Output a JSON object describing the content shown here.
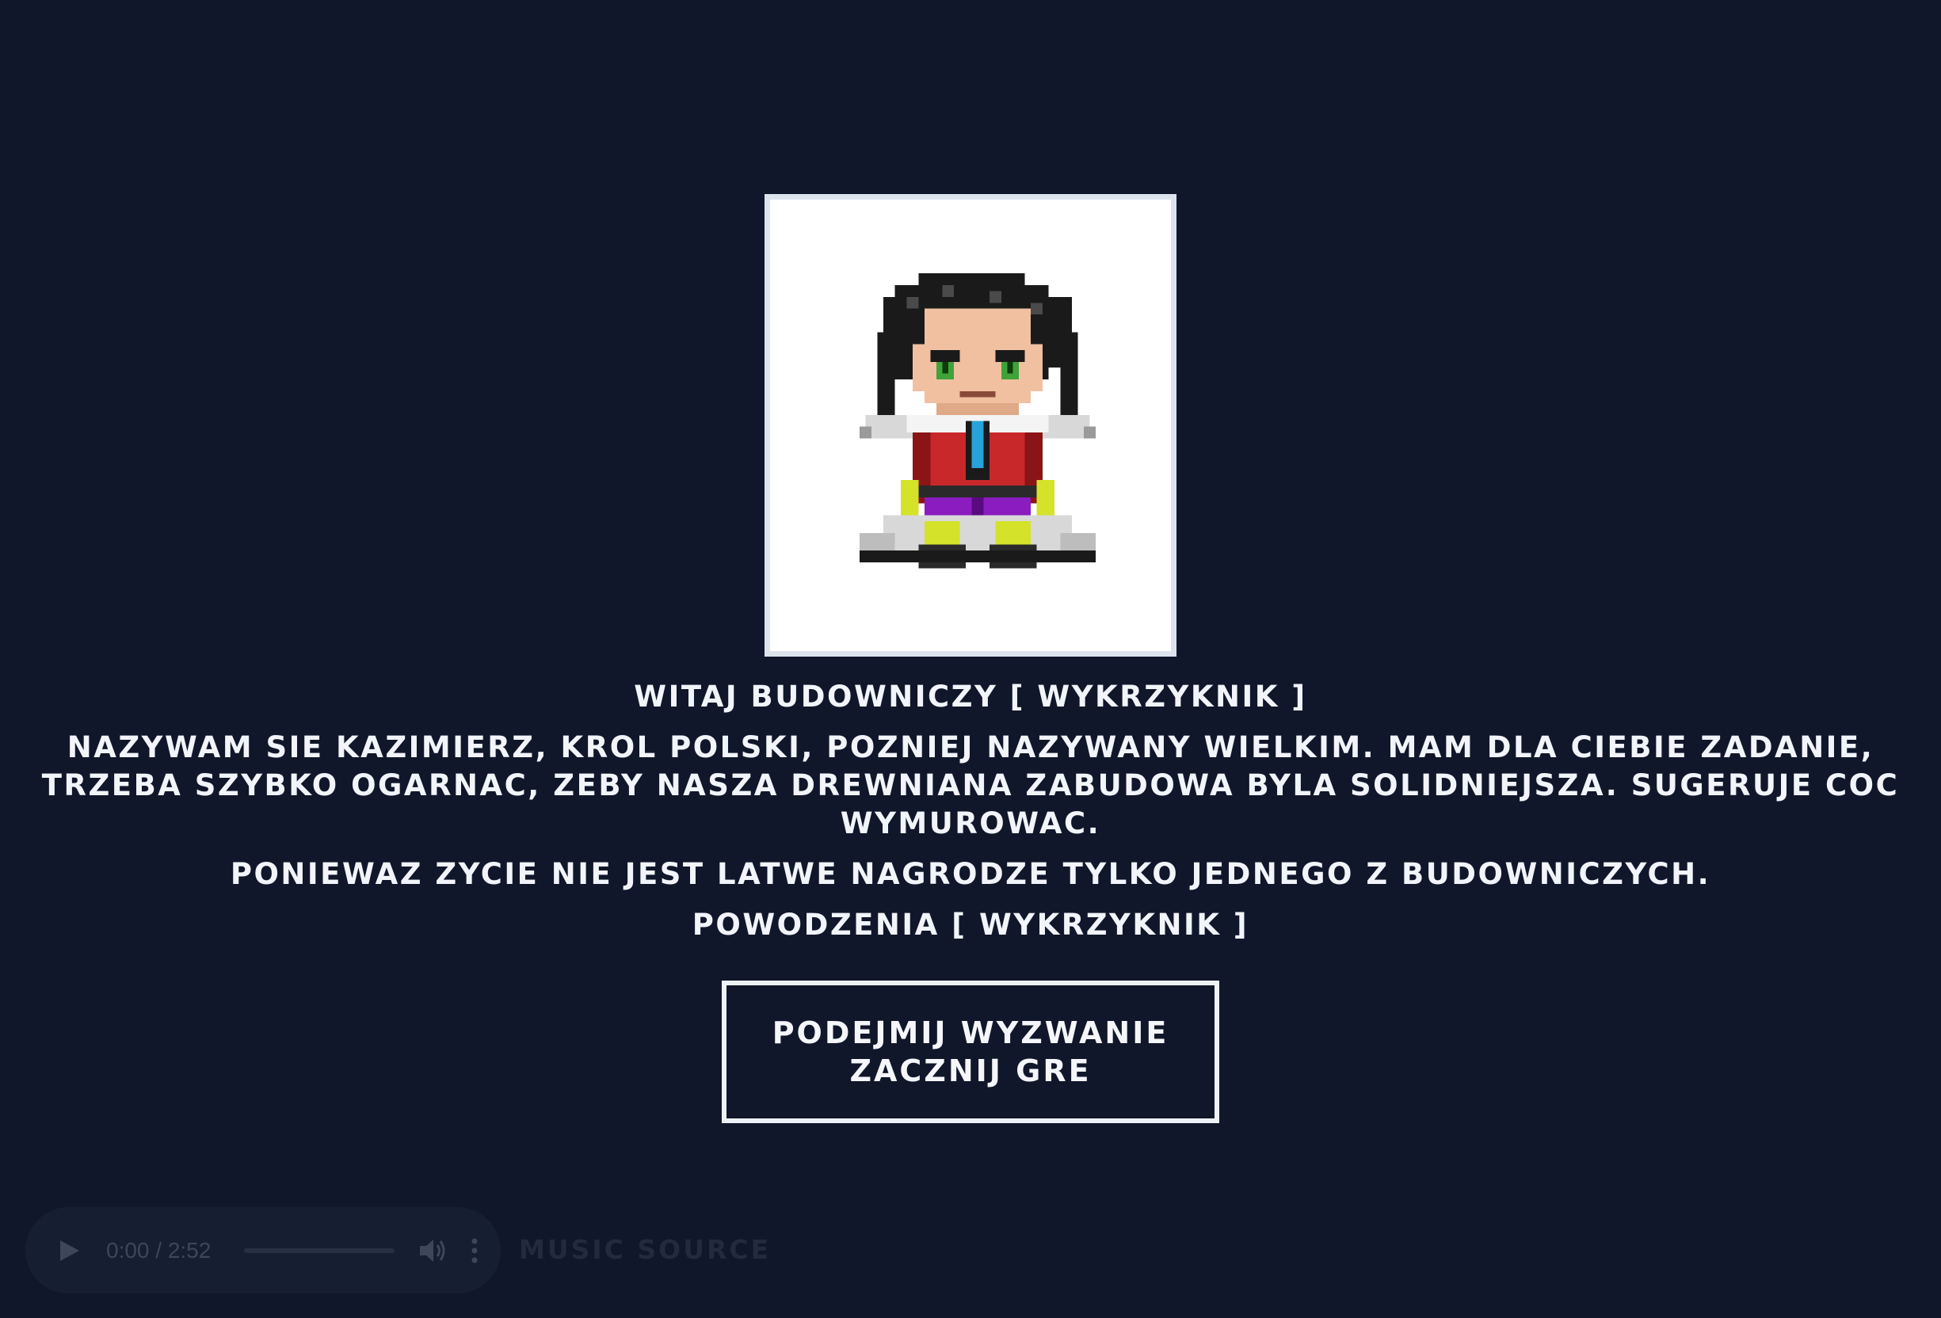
{
  "dialog": {
    "greeting": "WITAJ BUDOWNICZY [ WYKRZYKNIK ]",
    "intro": "NAZYWAM SIE KAZIMIERZ, KROL POLSKI, POZNIEJ NAZYWANY WIELKIM. MAM DLA CIEBIE ZADANIE, TRZEBA SZYBKO OGARNAC, ZEBY NASZA DREWNIANA ZABUDOWA BYLA SOLIDNIEJSZA. SUGERUJE COC WYMUROWAC.",
    "reward": "PONIEWAZ ZYCIE NIE JEST LATWE NAGRODZE TYLKO JEDNEGO Z BUDOWNICZYCH.",
    "luck": "POWODZENIA [ WYKRZYKNIK ]"
  },
  "start_button": {
    "line1": "PODEJMIJ WYZWANIE",
    "line2": "ZACZNIJ GRE"
  },
  "audio": {
    "time": "0:00 / 2:52",
    "progress": 0
  },
  "music_source_link": "MUSIC SOURCE",
  "colors": {
    "background": "#10172a",
    "text": "#f1f4f9",
    "frame_border": "#dde3ed",
    "player_bg": "#161e31"
  },
  "icons": {
    "portrait": "king-kazimierz-pixel-sprite",
    "play": "play-icon",
    "volume": "volume-icon",
    "menu": "more-vertical-icon"
  }
}
